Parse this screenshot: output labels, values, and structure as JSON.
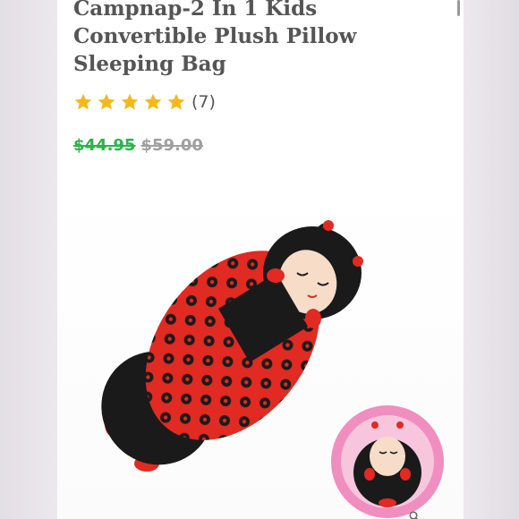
{
  "product": {
    "title": "Campnap-2 In 1 Kids Convertible Plush Pillow Sleeping Bag",
    "rating": {
      "stars": 5,
      "max_stars": 5,
      "review_count_label": "(7)",
      "star_color": "#f5b81c"
    },
    "price": {
      "sale_price": "$44.95",
      "original_price": "$59.00",
      "sale_color": "#2db34a",
      "original_color": "#a0a0a0"
    },
    "image": {
      "main_icon": "ladybug-sleeping-bag",
      "inset_icon": "ladybug-pillow",
      "colors": {
        "red": "#e02a22",
        "black": "#1a1a1a",
        "face": "#f7dcc8",
        "inset_ring": "#f08ec0"
      }
    },
    "zoom_icon": "search-icon"
  }
}
